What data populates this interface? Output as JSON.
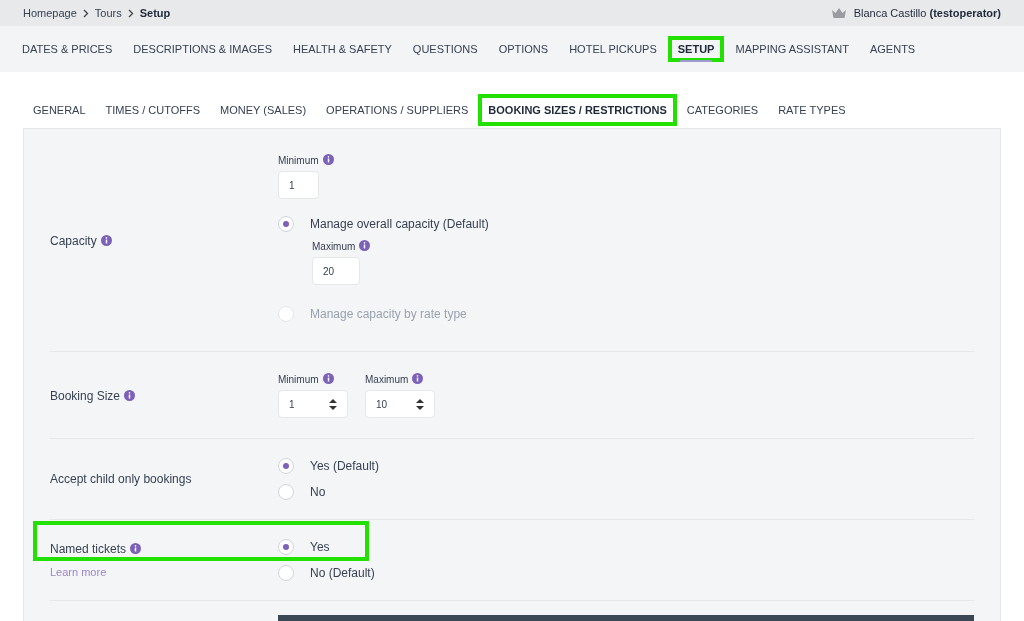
{
  "breadcrumb": [
    {
      "label": "Homepage",
      "current": false
    },
    {
      "label": "Tours",
      "current": false
    },
    {
      "label": "Setup",
      "current": true
    }
  ],
  "user": {
    "name": "Blanca Castillo",
    "account": "(testoperator)"
  },
  "main_tabs": [
    {
      "label": "DATES & PRICES",
      "selected": false,
      "highlighted": false
    },
    {
      "label": "DESCRIPTIONS & IMAGES",
      "selected": false,
      "highlighted": false
    },
    {
      "label": "HEALTH & SAFETY",
      "selected": false,
      "highlighted": false
    },
    {
      "label": "QUESTIONS",
      "selected": false,
      "highlighted": false
    },
    {
      "label": "OPTIONS",
      "selected": false,
      "highlighted": false
    },
    {
      "label": "HOTEL PICKUPS",
      "selected": false,
      "highlighted": false
    },
    {
      "label": "SETUP",
      "selected": true,
      "highlighted": true
    },
    {
      "label": "MAPPING ASSISTANT",
      "selected": false,
      "highlighted": false
    },
    {
      "label": "AGENTS",
      "selected": false,
      "highlighted": false
    }
  ],
  "sub_tabs": [
    {
      "label": "GENERAL",
      "selected": false,
      "highlighted": false
    },
    {
      "label": "TIMES / CUTOFFS",
      "selected": false,
      "highlighted": false
    },
    {
      "label": "MONEY (SALES)",
      "selected": false,
      "highlighted": false
    },
    {
      "label": "OPERATIONS / SUPPLIERS",
      "selected": false,
      "highlighted": false
    },
    {
      "label": "BOOKING SIZES / RESTRICTIONS",
      "selected": true,
      "highlighted": true
    },
    {
      "label": "CATEGORIES",
      "selected": false,
      "highlighted": false
    },
    {
      "label": "RATE TYPES",
      "selected": false,
      "highlighted": false
    }
  ],
  "settings": [
    {
      "kind": "capacity",
      "label": "Capacity",
      "info": true,
      "highlighted": false,
      "minimum": {
        "label": "Minimum",
        "value": "1"
      },
      "options": [
        {
          "label": "Manage overall capacity (Default)",
          "selected": true,
          "disabled": false,
          "maximum": {
            "label": "Maximum",
            "value": "20"
          }
        },
        {
          "label": "Manage capacity by rate type",
          "selected": false,
          "disabled": true
        }
      ]
    },
    {
      "kind": "range",
      "label": "Booking Size",
      "info": true,
      "highlighted": false,
      "fields": [
        {
          "label": "Minimum",
          "value": "1"
        },
        {
          "label": "Maximum",
          "value": "10"
        }
      ]
    },
    {
      "kind": "radio",
      "label": "Accept child only bookings",
      "info": false,
      "highlighted": false,
      "options": [
        {
          "label": "Yes (Default)",
          "selected": true,
          "disabled": false
        },
        {
          "label": "No",
          "selected": false,
          "disabled": false
        }
      ]
    },
    {
      "kind": "radio",
      "label": "Named tickets",
      "info": true,
      "highlighted": true,
      "link": "Learn more",
      "options": [
        {
          "label": "Yes",
          "selected": true,
          "disabled": false
        },
        {
          "label": "No (Default)",
          "selected": false,
          "disabled": false
        }
      ]
    },
    {
      "kind": "dark_panel",
      "highlighted": false
    }
  ]
}
